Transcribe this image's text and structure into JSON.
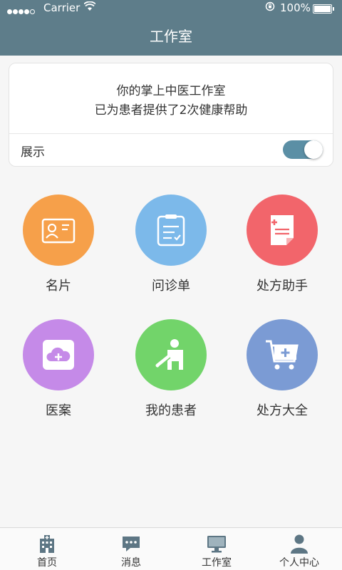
{
  "status_bar": {
    "carrier": "Carrier",
    "battery": "100%"
  },
  "nav": {
    "title": "工作室"
  },
  "info_card": {
    "line1": "你的掌上中医工作室",
    "line2": "已为患者提供了2次健康帮助",
    "toggle_label": "展示",
    "toggle_on": true
  },
  "grid": [
    {
      "label": "名片",
      "icon": "id-card-icon",
      "color": "#f6a04a"
    },
    {
      "label": "问诊单",
      "icon": "clipboard-icon",
      "color": "#7cb9ea"
    },
    {
      "label": "处方助手",
      "icon": "prescription-icon",
      "color": "#f2656b"
    },
    {
      "label": "医案",
      "icon": "cloud-case-icon",
      "color": "#c58ae8"
    },
    {
      "label": "我的患者",
      "icon": "patient-icon",
      "color": "#72d46a"
    },
    {
      "label": "处方大全",
      "icon": "medicine-cart-icon",
      "color": "#7b9bd4"
    }
  ],
  "tabs": [
    {
      "label": "首页",
      "icon": "hospital-icon"
    },
    {
      "label": "消息",
      "icon": "message-icon"
    },
    {
      "label": "工作室",
      "icon": "monitor-icon"
    },
    {
      "label": "个人中心",
      "icon": "person-icon"
    }
  ],
  "colors": {
    "nav_bg": "#5e7d8a",
    "toggle_on": "#5b8fa5",
    "tab_icon": "#5d7684"
  }
}
